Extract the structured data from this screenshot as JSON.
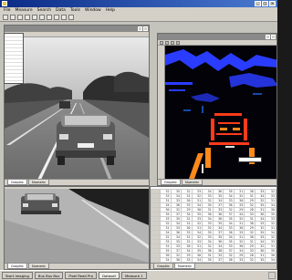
{
  "window": {
    "title": ""
  },
  "menu": [
    "File",
    "Measure",
    "Search",
    "Data",
    "Tools",
    "Window",
    "Help"
  ],
  "panes": {
    "video_tabs": [
      "Graphic",
      "Numeric"
    ],
    "edge_tabs": [
      "Graphic",
      "Numeric"
    ],
    "video_bottom_tabs": [
      "Graphic",
      "Numeric"
    ],
    "edge_readout": "",
    "table_tabs": [
      "Graphic",
      "Numeric"
    ]
  },
  "table": {
    "rows": [
      [
        "",
        "32",
        "35",
        "32",
        "33",
        "34",
        "36",
        "35",
        "31",
        "30",
        "33",
        "32"
      ],
      [
        "",
        "33",
        "34",
        "31",
        "32",
        "33",
        "35",
        "34",
        "32",
        "31",
        "34",
        "33"
      ],
      [
        "",
        "31",
        "33",
        "30",
        "31",
        "32",
        "34",
        "33",
        "30",
        "29",
        "32",
        "31"
      ],
      [
        "",
        "34",
        "36",
        "33",
        "34",
        "35",
        "37",
        "36",
        "33",
        "32",
        "35",
        "34"
      ],
      [
        "",
        "30",
        "32",
        "29",
        "30",
        "31",
        "33",
        "32",
        "29",
        "28",
        "31",
        "30"
      ],
      [
        "",
        "35",
        "37",
        "34",
        "35",
        "36",
        "38",
        "37",
        "34",
        "33",
        "36",
        "35"
      ],
      [
        "",
        "33",
        "35",
        "32",
        "33",
        "34",
        "36",
        "35",
        "32",
        "31",
        "34",
        "33"
      ],
      [
        "",
        "32",
        "34",
        "31",
        "32",
        "33",
        "35",
        "34",
        "31",
        "30",
        "33",
        "32"
      ],
      [
        "",
        "31",
        "33",
        "30",
        "31",
        "32",
        "34",
        "33",
        "30",
        "29",
        "32",
        "31"
      ],
      [
        "",
        "34",
        "36",
        "33",
        "34",
        "35",
        "37",
        "36",
        "33",
        "32",
        "35",
        "34"
      ],
      [
        "",
        "32",
        "34",
        "31",
        "32",
        "33",
        "35",
        "34",
        "31",
        "30",
        "33",
        "32"
      ],
      [
        "",
        "33",
        "35",
        "32",
        "33",
        "34",
        "36",
        "35",
        "32",
        "31",
        "34",
        "33"
      ],
      [
        "",
        "31",
        "33",
        "30",
        "31",
        "32",
        "34",
        "33",
        "30",
        "29",
        "32",
        "31"
      ],
      [
        "",
        "35",
        "37",
        "34",
        "35",
        "36",
        "38",
        "37",
        "34",
        "33",
        "36",
        "35"
      ],
      [
        "",
        "30",
        "32",
        "29",
        "30",
        "31",
        "33",
        "32",
        "29",
        "28",
        "31",
        "30"
      ],
      [
        "",
        "34",
        "36",
        "33",
        "34",
        "35",
        "37",
        "36",
        "33",
        "32",
        "35",
        "34"
      ]
    ]
  },
  "taskbar": {
    "tasks": [
      "Start Imaging",
      "Bus Bus Bus",
      "Pixel Read Pro",
      "Dataset",
      "Measure 1"
    ],
    "clock": ""
  },
  "icons": {
    "app": "app-icon",
    "minimize": "minimize-icon",
    "maximize": "maximize-icon",
    "close": "close-icon"
  },
  "colors": {
    "title_start": "#0a2a86",
    "title_end": "#4b7bd0",
    "edge_bg": "#020208",
    "edge_blue": "#2a3cff",
    "edge_red": "#ff3b1a",
    "edge_orange": "#ff8a1a"
  }
}
